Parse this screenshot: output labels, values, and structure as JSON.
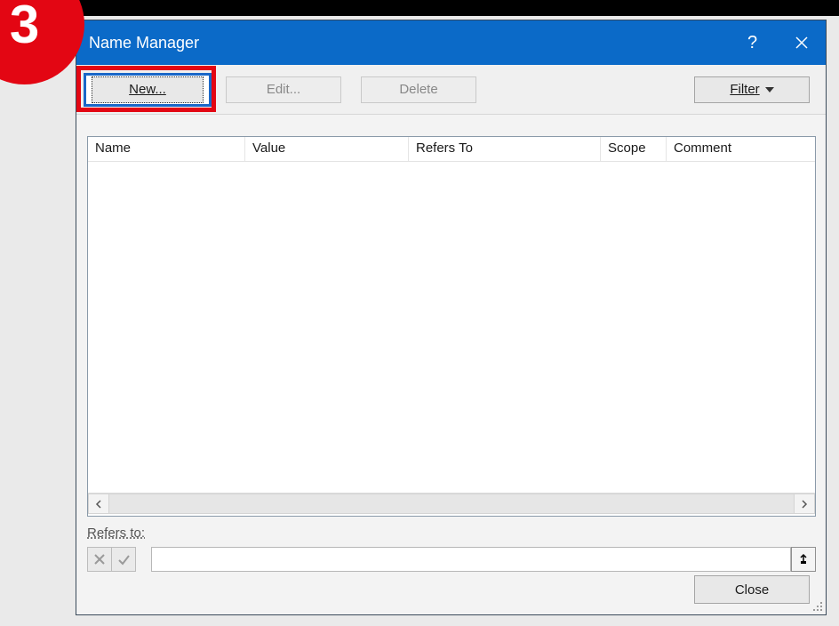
{
  "step_badge": "3",
  "titlebar": {
    "title": "Name Manager",
    "help_tooltip": "?",
    "close_tooltip": "Close"
  },
  "toolbar": {
    "new_label": "New...",
    "edit_label": "Edit...",
    "delete_label": "Delete",
    "filter_label": "Filter"
  },
  "columns": {
    "name": "Name",
    "value": "Value",
    "refers_to": "Refers To",
    "scope": "Scope",
    "comment": "Comment"
  },
  "refers_to_label": "Refers to:",
  "refers_to_value": "",
  "close_label": "Close"
}
